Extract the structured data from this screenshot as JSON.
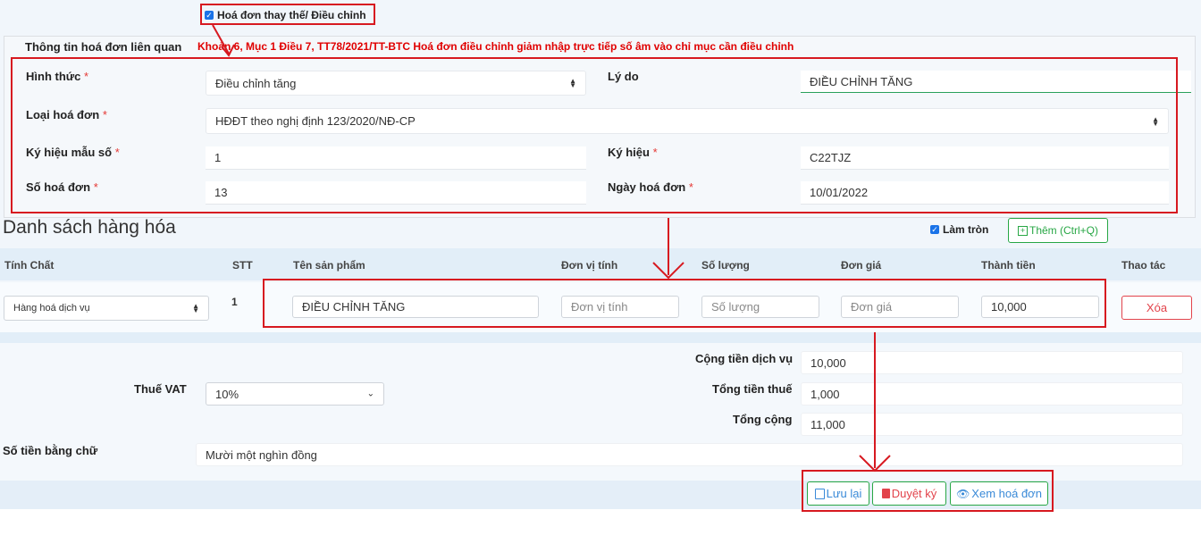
{
  "replace_adjust": {
    "checked": true,
    "label": "Hoá đơn thay thế/ Điều chỉnh"
  },
  "related": {
    "section_title": "Thông tin hoá đơn liên quan",
    "annotation": "Khoản 6, Mục 1 Điều 7, TT78/2021/TT-BTC Hoá đơn điều chỉnh giảm nhập trực tiếp số âm vào chỉ mục cần điều chỉnh",
    "required_mark": "*",
    "form_label": "Hình thức",
    "form_value": "Điều chỉnh tăng",
    "reason_label": "Lý do",
    "reason_value": "ĐIỀU CHỈNH TĂNG",
    "type_label": "Loại hoá đơn",
    "type_value": "HĐĐT theo nghị định 123/2020/NĐ-CP",
    "template_label": "Ký hiệu mẫu số",
    "template_value": "1",
    "symbol_label": "Ký hiệu",
    "symbol_value": "C22TJZ",
    "number_label": "Số hoá đơn",
    "number_value": "13",
    "date_label": "Ngày hoá đơn",
    "date_value": "10/01/2022"
  },
  "goods": {
    "title": "Danh sách hàng hóa",
    "round_checked": true,
    "round_label": "Làm tròn",
    "add_label": "Thêm (Ctrl+Q)",
    "headers": [
      "Tính Chất",
      "STT",
      "Tên sản phẩm",
      "Đơn vị tính",
      "Số lượng",
      "Đơn giá",
      "Thành tiền",
      "Thao tác"
    ],
    "row": {
      "nature": "Hàng hoá dịch vụ",
      "stt": "1",
      "product": "ĐIỀU CHỈNH TĂNG",
      "unit_placeholder": "Đơn vị tính",
      "qty_placeholder": "Số lượng",
      "price_placeholder": "Đơn giá",
      "amount": "10,000",
      "delete_label": "Xóa"
    }
  },
  "summary": {
    "service_total_label": "Cộng tiền dịch vụ",
    "service_total_value": "10,000",
    "vat_label": "Thuế VAT",
    "vat_value": "10%",
    "tax_total_label": "Tổng tiền thuế",
    "tax_total_value": "1,000",
    "grand_total_label": "Tổng cộng",
    "grand_total_value": "11,000",
    "words_label": "Số tiền bằng chữ",
    "words_value": "Mười một nghìn đồng"
  },
  "actions": {
    "save_label": "Lưu lại",
    "approve_label": "Duyệt ký",
    "view_label": "Xem hoá đơn"
  },
  "colors": {
    "annotation_red": "#d71920",
    "button_green": "#28a745",
    "header_band": "#e2eef8"
  }
}
